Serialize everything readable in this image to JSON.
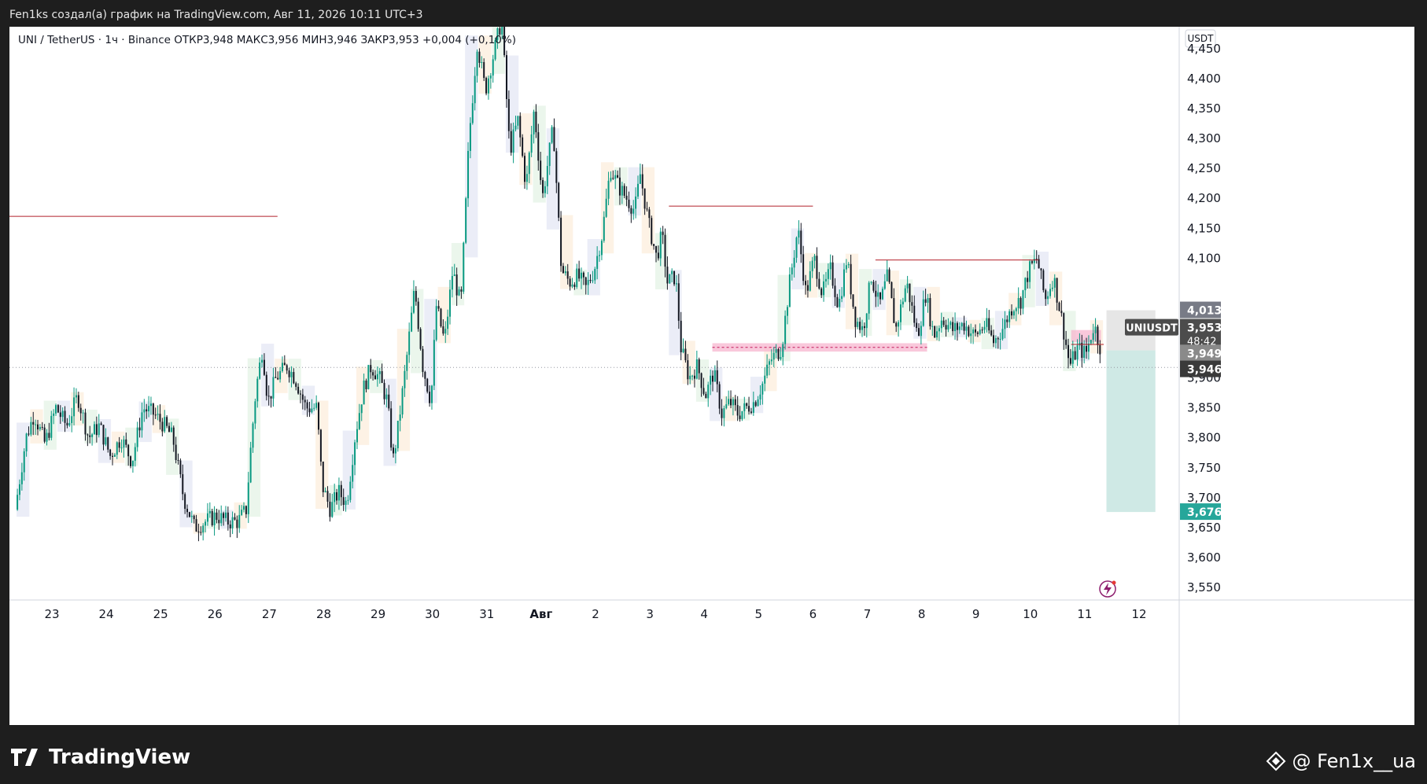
{
  "header": {
    "credit": "Fen1ks создал(а) график на TradingView.com, Авг 11, 2026 10:11 UTC+3"
  },
  "legend": {
    "text": "UNI / TetherUS · 1ч · Binance  ОТКР3,948  МАКС3,956  МИН3,946  ЗАКР3,953  +0,004 (+0,10%)"
  },
  "footer": {
    "brand": "TradingView",
    "author": "@ Fen1x__ua"
  },
  "colors": {
    "up": "#089981",
    "down": "#131722",
    "red_line": "#b2202a",
    "pink_zone": "#f7b6cf",
    "target_zone": "#cfe9e5",
    "target_label": "#26a69a",
    "price_label": "#4c4c4c"
  },
  "chart_data": {
    "type": "candlestick",
    "symbol": "UNI / TetherUS",
    "interval": "1ч",
    "exchange": "Binance",
    "ohlc": {
      "open": 3.948,
      "high": 3.956,
      "low": 3.946,
      "close": 3.953,
      "change": "+0,004 (+0,10%)"
    },
    "quote_currency": "USDT",
    "ylim": [
      3.52,
      4.45
    ],
    "y_ticks": [
      {
        "v": 3.55,
        "label": "3,550"
      },
      {
        "v": 3.6,
        "label": "3,600"
      },
      {
        "v": 3.65,
        "label": "3,650"
      },
      {
        "v": 3.7,
        "label": "3,700"
      },
      {
        "v": 3.75,
        "label": "3,750"
      },
      {
        "v": 3.8,
        "label": "3,800"
      },
      {
        "v": 3.85,
        "label": "3,850"
      },
      {
        "v": 3.9,
        "label": "3,900"
      },
      {
        "v": 4.1,
        "label": "4,100"
      },
      {
        "v": 4.15,
        "label": "4,150"
      },
      {
        "v": 4.2,
        "label": "4,200"
      },
      {
        "v": 4.25,
        "label": "4,250"
      },
      {
        "v": 4.3,
        "label": "4,300"
      },
      {
        "v": 4.35,
        "label": "4,350"
      },
      {
        "v": 4.4,
        "label": "4,400"
      },
      {
        "v": 4.45,
        "label": "4,450"
      }
    ],
    "x_ticks": [
      {
        "d": 0,
        "label": "23"
      },
      {
        "d": 1,
        "label": "24"
      },
      {
        "d": 2,
        "label": "25"
      },
      {
        "d": 3,
        "label": "26"
      },
      {
        "d": 4,
        "label": "27"
      },
      {
        "d": 5,
        "label": "28"
      },
      {
        "d": 6,
        "label": "29"
      },
      {
        "d": 7,
        "label": "30"
      },
      {
        "d": 8,
        "label": "31"
      },
      {
        "d": 9,
        "label": "Авг"
      },
      {
        "d": 10,
        "label": "2"
      },
      {
        "d": 11,
        "label": "3"
      },
      {
        "d": 12,
        "label": "4"
      },
      {
        "d": 13,
        "label": "5"
      },
      {
        "d": 14,
        "label": "6"
      },
      {
        "d": 15,
        "label": "7"
      },
      {
        "d": 16,
        "label": "8"
      },
      {
        "d": 17,
        "label": "9"
      },
      {
        "d": 18,
        "label": "10"
      },
      {
        "d": 19,
        "label": "11"
      },
      {
        "d": 20,
        "label": "12"
      }
    ],
    "price_path": [
      [
        -0.65,
        3.68
      ],
      [
        -0.45,
        3.8
      ],
      [
        -0.3,
        3.84
      ],
      [
        -0.1,
        3.79
      ],
      [
        0.1,
        3.85
      ],
      [
        0.3,
        3.82
      ],
      [
        0.5,
        3.87
      ],
      [
        0.7,
        3.8
      ],
      [
        0.9,
        3.82
      ],
      [
        1.1,
        3.77
      ],
      [
        1.3,
        3.8
      ],
      [
        1.5,
        3.76
      ],
      [
        1.7,
        3.85
      ],
      [
        1.9,
        3.84
      ],
      [
        2.1,
        3.82
      ],
      [
        2.25,
        3.8
      ],
      [
        2.45,
        3.7
      ],
      [
        2.65,
        3.65
      ],
      [
        2.85,
        3.66
      ],
      [
        3.05,
        3.67
      ],
      [
        3.25,
        3.66
      ],
      [
        3.45,
        3.66
      ],
      [
        3.6,
        3.68
      ],
      [
        3.7,
        3.8
      ],
      [
        3.78,
        3.88
      ],
      [
        3.9,
        3.95
      ],
      [
        4.0,
        3.86
      ],
      [
        4.15,
        3.9
      ],
      [
        4.35,
        3.92
      ],
      [
        4.5,
        3.9
      ],
      [
        4.7,
        3.85
      ],
      [
        4.9,
        3.85
      ],
      [
        5.0,
        3.72
      ],
      [
        5.15,
        3.68
      ],
      [
        5.3,
        3.71
      ],
      [
        5.45,
        3.69
      ],
      [
        5.6,
        3.8
      ],
      [
        5.75,
        3.88
      ],
      [
        5.9,
        3.92
      ],
      [
        6.05,
        3.9
      ],
      [
        6.2,
        3.86
      ],
      [
        6.3,
        3.76
      ],
      [
        6.4,
        3.82
      ],
      [
        6.55,
        3.93
      ],
      [
        6.7,
        4.05
      ],
      [
        6.85,
        3.92
      ],
      [
        7.0,
        3.86
      ],
      [
        7.1,
        4.02
      ],
      [
        7.25,
        3.96
      ],
      [
        7.4,
        4.08
      ],
      [
        7.55,
        4.02
      ],
      [
        7.7,
        4.3
      ],
      [
        7.85,
        4.46
      ],
      [
        8.0,
        4.38
      ],
      [
        8.15,
        4.44
      ],
      [
        8.3,
        4.5
      ],
      [
        8.45,
        4.28
      ],
      [
        8.6,
        4.33
      ],
      [
        8.75,
        4.22
      ],
      [
        8.9,
        4.35
      ],
      [
        9.05,
        4.2
      ],
      [
        9.25,
        4.32
      ],
      [
        9.4,
        4.08
      ],
      [
        9.55,
        4.06
      ],
      [
        9.7,
        4.07
      ],
      [
        9.85,
        4.05
      ],
      [
        10.0,
        4.08
      ],
      [
        10.15,
        4.14
      ],
      [
        10.3,
        4.25
      ],
      [
        10.45,
        4.22
      ],
      [
        10.6,
        4.2
      ],
      [
        10.75,
        4.18
      ],
      [
        10.85,
        4.24
      ],
      [
        11.0,
        4.16
      ],
      [
        11.15,
        4.1
      ],
      [
        11.25,
        4.14
      ],
      [
        11.35,
        4.06
      ],
      [
        11.5,
        4.07
      ],
      [
        11.6,
        3.95
      ],
      [
        11.75,
        3.9
      ],
      [
        11.9,
        3.92
      ],
      [
        12.05,
        3.87
      ],
      [
        12.2,
        3.91
      ],
      [
        12.35,
        3.84
      ],
      [
        12.5,
        3.86
      ],
      [
        12.65,
        3.84
      ],
      [
        12.8,
        3.85
      ],
      [
        12.95,
        3.86
      ],
      [
        13.1,
        3.89
      ],
      [
        13.25,
        3.93
      ],
      [
        13.45,
        3.95
      ],
      [
        13.6,
        4.06
      ],
      [
        13.75,
        4.15
      ],
      [
        13.9,
        4.04
      ],
      [
        14.05,
        4.1
      ],
      [
        14.2,
        4.04
      ],
      [
        14.35,
        4.08
      ],
      [
        14.5,
        4.02
      ],
      [
        14.65,
        4.1
      ],
      [
        14.8,
        4.0
      ],
      [
        14.95,
        3.98
      ],
      [
        15.1,
        4.07
      ],
      [
        15.25,
        4.02
      ],
      [
        15.4,
        4.07
      ],
      [
        15.55,
        3.98
      ],
      [
        15.75,
        4.06
      ],
      [
        15.95,
        3.97
      ],
      [
        16.1,
        4.04
      ],
      [
        16.25,
        3.97
      ],
      [
        16.4,
        4.0
      ],
      [
        16.6,
        3.98
      ],
      [
        16.8,
        3.99
      ],
      [
        17.0,
        3.97
      ],
      [
        17.2,
        3.99
      ],
      [
        17.35,
        3.96
      ],
      [
        17.5,
        3.98
      ],
      [
        17.7,
        4.02
      ],
      [
        17.85,
        4.03
      ],
      [
        18.0,
        4.08
      ],
      [
        18.15,
        4.1
      ],
      [
        18.3,
        4.03
      ],
      [
        18.45,
        4.07
      ],
      [
        18.6,
        4.0
      ],
      [
        18.75,
        3.92
      ],
      [
        18.9,
        3.95
      ],
      [
        19.05,
        3.94
      ],
      [
        19.2,
        3.99
      ],
      [
        19.3,
        3.953
      ]
    ],
    "last_price": {
      "v": 3.953,
      "label": "3,953",
      "symbol": "UNIUSDT",
      "countdown": "48:42"
    },
    "price_labels": [
      {
        "v": 4.013,
        "label": "4,013"
      },
      {
        "v": 3.949,
        "label": "3,949"
      },
      {
        "v": 3.946,
        "label": "3,946"
      },
      {
        "v": 3.676,
        "label": "3,676"
      }
    ],
    "horizontal_lines": [
      {
        "d0": -0.8,
        "d1": 4.15,
        "v": 4.17
      },
      {
        "d0": 11.35,
        "d1": 14.0,
        "v": 4.187
      },
      {
        "d0": 15.15,
        "d1": 18.15,
        "v": 4.097
      },
      {
        "d0": 18.75,
        "d1": 19.35,
        "v": 3.956
      }
    ],
    "zones": [
      {
        "d0": 12.15,
        "d1": 16.1,
        "top": 3.958,
        "bottom": 3.944,
        "kind": "pink"
      },
      {
        "d0": 18.75,
        "d1": 19.3,
        "top": 3.98,
        "bottom": 3.96,
        "kind": "pink"
      },
      {
        "d0": 19.4,
        "d1": 20.3,
        "top": 4.013,
        "bottom": 3.946,
        "kind": "grey"
      },
      {
        "d0": 19.4,
        "d1": 20.3,
        "top": 3.946,
        "bottom": 3.676,
        "kind": "target"
      }
    ],
    "dotted_line": {
      "v": 3.953
    }
  }
}
